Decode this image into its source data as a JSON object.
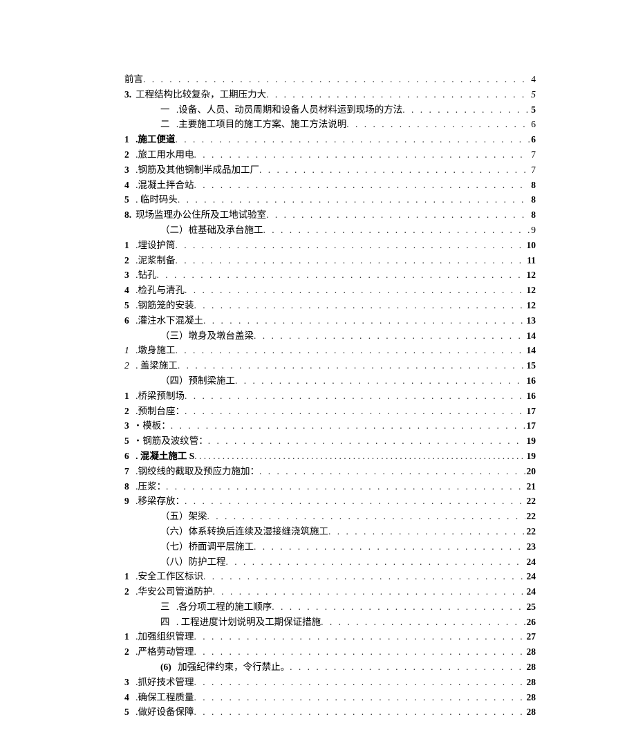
{
  "toc": [
    {
      "indent": 0,
      "num": "",
      "title": "前言",
      "page": "4",
      "bold_num": false,
      "bold_page": false
    },
    {
      "indent": 0,
      "num": "3.",
      "title": "工程结构比较复杂，工期压力大",
      "page": "5",
      "bold_num": true,
      "bold_page": false,
      "italic_page": true
    },
    {
      "indent": 1,
      "num": "一",
      "title": " .设备、人员、动员周期和设备人员材料运到现场的方法",
      "page": "5",
      "bold_num": false,
      "bold_page": true
    },
    {
      "indent": 1,
      "num": "二",
      "title": " .主要施工项目的施工方案、施工方法说明",
      "page": "6",
      "bold_num": false,
      "bold_page": false
    },
    {
      "indent": 0,
      "num": "1",
      "title": " .施工便道",
      "page": "6",
      "bold_num": true,
      "bold_page": true,
      "bold_title": true
    },
    {
      "indent": 0,
      "num": "2",
      "title": " .旅工用水用电",
      "page": "7",
      "bold_num": true,
      "bold_page": false
    },
    {
      "indent": 0,
      "num": "3",
      "title": " .钢筋及其他钢制半成品加工厂",
      "page": "7",
      "bold_num": true,
      "bold_page": false
    },
    {
      "indent": 0,
      "num": "4",
      "title": " .混凝土拌合站",
      "page": "8",
      "bold_num": true,
      "bold_page": true
    },
    {
      "indent": 0,
      "num": "5",
      "title": " . 临时码头",
      "page": "8",
      "bold_num": true,
      "bold_page": true
    },
    {
      "indent": 0,
      "num": "8.",
      "title": "现场监理办公住所及工地试验室",
      "page": "8",
      "bold_num": true,
      "bold_page": true
    },
    {
      "indent": 1,
      "num": "",
      "title": "（二）桩基础及承台施工",
      "page": "9",
      "bold_num": false,
      "bold_page": false
    },
    {
      "indent": 0,
      "num": "1",
      "title": " .埋设护筒",
      "page": "10",
      "bold_num": true,
      "bold_page": true
    },
    {
      "indent": 0,
      "num": "2",
      "title": " .泥浆制备",
      "page": "11",
      "bold_num": true,
      "bold_page": true
    },
    {
      "indent": 0,
      "num": "3",
      "title": " .钻孔",
      "page": "12",
      "bold_num": true,
      "bold_page": true
    },
    {
      "indent": 0,
      "num": "4",
      "title": " .检孔与清孔",
      "page": "12",
      "bold_num": true,
      "bold_page": true
    },
    {
      "indent": 0,
      "num": "5",
      "title": " .钢筋笼的安装",
      "page": "12",
      "bold_num": true,
      "bold_page": true
    },
    {
      "indent": 0,
      "num": "6",
      "title": " .灌注水下混凝土",
      "page": "13",
      "bold_num": true,
      "bold_page": true,
      "bold_partial": "灌"
    },
    {
      "indent": 1,
      "num": "",
      "title": "（三）墩身及墩台盖梁",
      "page": "14",
      "bold_num": false,
      "bold_page": true
    },
    {
      "indent": 0,
      "num": "1",
      "title": " .墩身施工",
      "page": "14",
      "bold_num": false,
      "bold_page": true,
      "italic_num": true
    },
    {
      "indent": 0,
      "num": "2",
      "title": " . 盖梁施工",
      "page": "15",
      "bold_num": false,
      "bold_page": true,
      "italic_num": true
    },
    {
      "indent": 1,
      "num": "",
      "title": "（四）预制梁施工",
      "page": "16",
      "bold_num": false,
      "bold_page": true
    },
    {
      "indent": 0,
      "num": "1",
      "title": " .桥梁预制场",
      "page": "16",
      "bold_num": true,
      "bold_page": true
    },
    {
      "indent": 0,
      "num": "2",
      "title": " .预制台座：",
      "page": "17",
      "bold_num": true,
      "bold_page": true
    },
    {
      "indent": 0,
      "num": "3",
      "title": "・模板：",
      "page": "17",
      "bold_num": true,
      "bold_page": true
    },
    {
      "indent": 0,
      "num": "5",
      "title": "・钢筋及波纹管：",
      "page": "19",
      "bold_num": true,
      "bold_page": true
    },
    {
      "indent": 0,
      "num": "6",
      "title": " . 混凝土施工 S",
      "page": "19",
      "bold_num": true,
      "bold_page": true,
      "bold_title": true,
      "solid_dots": true
    },
    {
      "indent": 0,
      "num": "7",
      "title": " .钢绞线的截取及预应力施加：",
      "page": "20",
      "bold_num": true,
      "bold_page": true
    },
    {
      "indent": 0,
      "num": "8",
      "title": " .压浆：",
      "page": "21",
      "bold_num": true,
      "bold_page": true
    },
    {
      "indent": 0,
      "num": "9",
      "title": " .移梁存放：",
      "page": "22",
      "bold_num": true,
      "bold_page": true
    },
    {
      "indent": 1,
      "num": "",
      "title": "（五）架梁",
      "page": "22",
      "bold_num": false,
      "bold_page": true
    },
    {
      "indent": 1,
      "num": "",
      "title": "（六）体系转换后连续及湿接缝浇筑施工",
      "page": "22",
      "bold_num": false,
      "bold_page": true
    },
    {
      "indent": 1,
      "num": "",
      "title": "（七）桥面调平层施工",
      "page": "23",
      "bold_num": false,
      "bold_page": true
    },
    {
      "indent": 1,
      "num": "",
      "title": "（八）防护工程",
      "page": "24",
      "bold_num": false,
      "bold_page": true
    },
    {
      "indent": 0,
      "num": "1",
      "title": " .安全工作区标识",
      "page": "24",
      "bold_num": true,
      "bold_page": true
    },
    {
      "indent": 0,
      "num": "2",
      "title": " .华安公司管道防护",
      "page": "24",
      "bold_num": true,
      "bold_page": true
    },
    {
      "indent": 1,
      "num": "三",
      "title": "  .各分项工程的施工顺序",
      "page": "25",
      "bold_num": false,
      "bold_page": true
    },
    {
      "indent": 1,
      "num": "四",
      "title": "  . 工程进度计划说明及工期保证措施",
      "page": "26",
      "bold_num": false,
      "bold_page": true
    },
    {
      "indent": 0,
      "num": "1",
      "title": " .加强组织管理",
      "page": "27",
      "bold_num": true,
      "bold_page": true
    },
    {
      "indent": 0,
      "num": "2",
      "title": " .严格劳动管理",
      "page": "28",
      "bold_num": true,
      "bold_page": true,
      "bold_partial2": "严"
    },
    {
      "indent": 1,
      "num": "(6)",
      "title": "  加强纪律约束，令行禁止。",
      "page": "28",
      "bold_num": true,
      "bold_page": true
    },
    {
      "indent": 0,
      "num": "3",
      "title": " .抓好技术管理",
      "page": "28",
      "bold_num": true,
      "bold_page": true
    },
    {
      "indent": 0,
      "num": "4",
      "title": " .确保工程质量",
      "page": "28",
      "bold_num": true,
      "bold_page": true,
      "bold_partial3": "程质量"
    },
    {
      "indent": 0,
      "num": "5",
      "title": " .做好设备保障",
      "page": "28",
      "bold_num": true,
      "bold_page": true
    }
  ]
}
